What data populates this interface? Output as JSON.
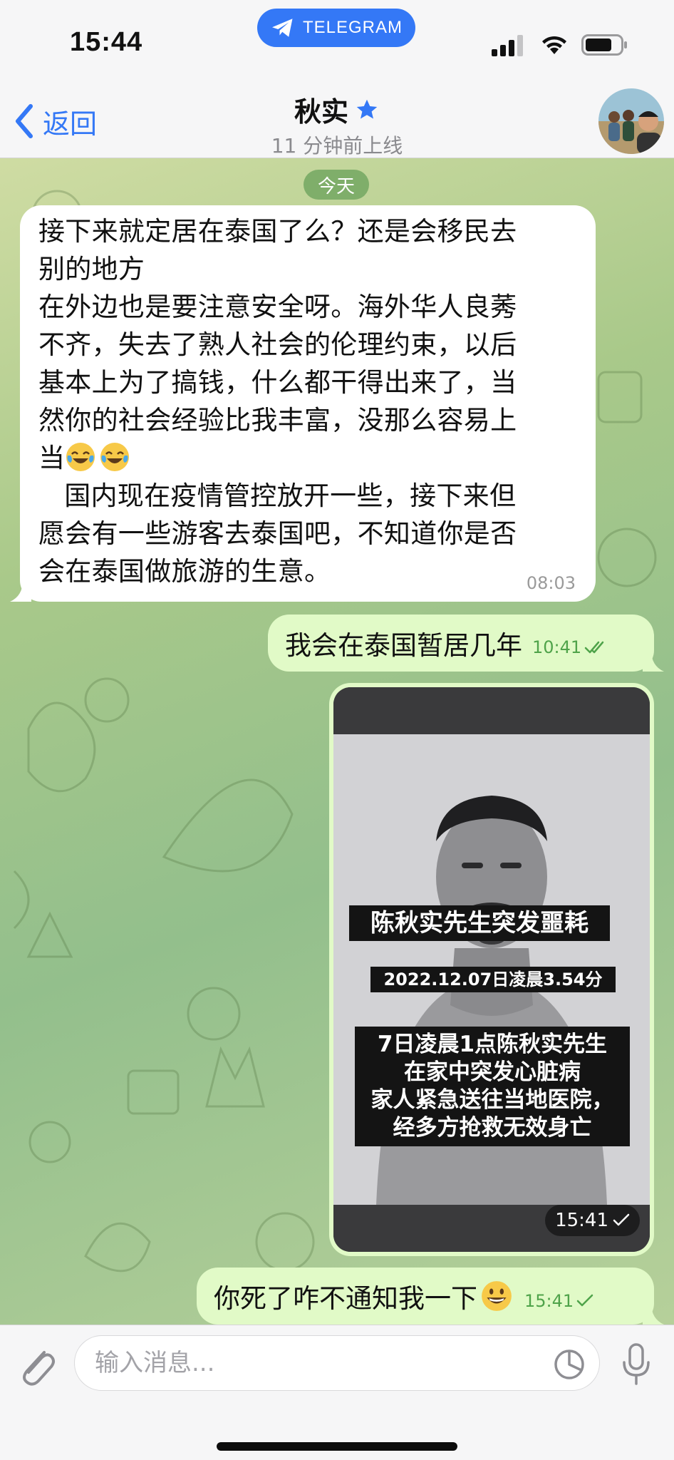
{
  "status_bar": {
    "time": "15:44",
    "app_pill": "TELEGRAM",
    "icons": [
      "signal-icon",
      "wifi-icon",
      "battery-icon"
    ]
  },
  "header": {
    "back_label": "返回",
    "title": "秋实",
    "subtitle": "11 分钟前上线",
    "icons": [
      "chevron-left-icon",
      "star-icon",
      "avatar"
    ]
  },
  "chat": {
    "date_label": "今天",
    "messages": [
      {
        "direction": "incoming",
        "text_part1": "接下来就定居在泰国了么？还是会移民去\n别的地方\n在外边也是要注意安全呀。海外华人良莠\n不齐，失去了熟人社会的伦理约束，以后\n基本上为了搞钱，什么都干得出来了，当\n然你的社会经验比我丰富，没那么容易上\n当",
        "emoji_part": [
          "face-with-tears-of-joy",
          "face-with-tears-of-joy"
        ],
        "text_part2": "\n   国内现在疫情管控放开一些，接下来但\n愿会有一些游客去泰国吧，不知道你是否\n会在泰国做旅游的生意。",
        "time": "08:03"
      },
      {
        "direction": "outgoing",
        "text": "我会在泰国暂居几年",
        "time": "10:41",
        "status": "read"
      },
      {
        "direction": "outgoing",
        "type": "video",
        "caption_headline": "陈秋实先生突发噩耗",
        "caption_time": "2022.12.07日凌晨3.54分",
        "caption_body": "7日凌晨1点陈秋实先生\n在家中突发心脏病\n家人紧急送往当地医院，\n经多方抢救无效身亡",
        "time": "15:41",
        "status": "sent"
      },
      {
        "direction": "outgoing",
        "text": "你死了咋不通知我一下",
        "emoji": "grinning-face",
        "time": "15:41",
        "status": "sent"
      }
    ]
  },
  "input": {
    "placeholder": "输入消息...",
    "value": "",
    "icons": [
      "paperclip-icon",
      "sticker-icon",
      "microphone-icon"
    ]
  },
  "colors": {
    "accent": "#3478f6",
    "outgoing_bubble": "#e1fac7",
    "incoming_bubble": "#ffffff",
    "read_check": "#4fa34a",
    "wallpaper": "#a9c98a"
  }
}
